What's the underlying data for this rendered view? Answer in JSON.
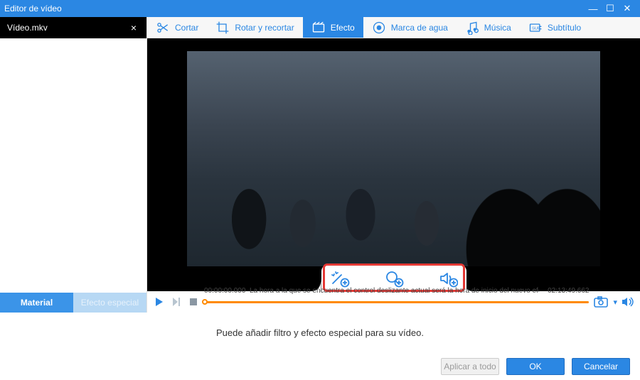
{
  "window": {
    "title": "Editor de vídeo"
  },
  "file": {
    "name": "Vídeo.mkv"
  },
  "toolbar": {
    "cut": {
      "label": "Cortar"
    },
    "rotate": {
      "label": "Rotar y recortar"
    },
    "effect": {
      "label": "Efecto"
    },
    "watermark": {
      "label": "Marca de agua"
    },
    "music": {
      "label": "Música"
    },
    "subtitle": {
      "label": "Subtítulo"
    }
  },
  "side_tabs": {
    "material": "Material",
    "special": "Efecto especial"
  },
  "timeline": {
    "start": "00:00:00.000",
    "end": "02:13:49.662",
    "hint": "La hora a la que se encuentra el control deslizante actual será la hora de inicio del nuevo efecto especial"
  },
  "hint_text": "Puede añadir filtro y efecto especial para su vídeo.",
  "buttons": {
    "apply_all": "Aplicar a todo",
    "ok": "OK",
    "cancel": "Cancelar"
  }
}
